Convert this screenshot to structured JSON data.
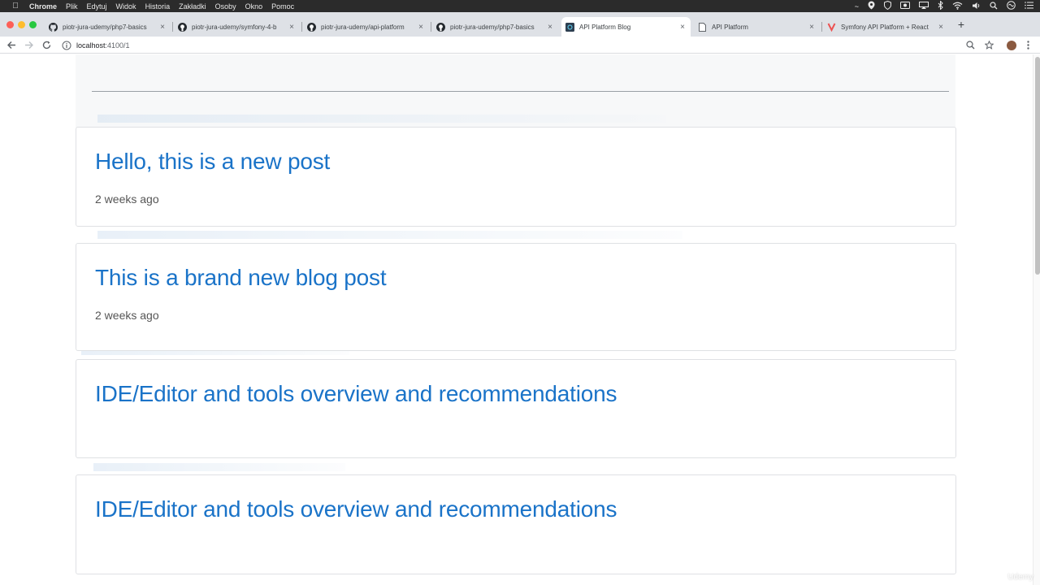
{
  "menubar": {
    "app": "Chrome",
    "items": [
      "Plik",
      "Edytuj",
      "Widok",
      "Historia",
      "Zakładki",
      "Osoby",
      "Okno",
      "Pomoc"
    ]
  },
  "tabs": [
    {
      "title": "piotr-jura-udemy/php7-basics",
      "icon": "github-icon",
      "active": false
    },
    {
      "title": "piotr-jura-udemy/symfony-4-b",
      "icon": "github-icon",
      "active": false
    },
    {
      "title": "piotr-jura-udemy/api-platform",
      "icon": "github-icon",
      "active": false
    },
    {
      "title": "piotr-jura-udemy/php7-basics",
      "icon": "github-icon",
      "active": false
    },
    {
      "title": "API Platform Blog",
      "icon": "react-app-icon",
      "active": true
    },
    {
      "title": "API Platform",
      "icon": "page-icon",
      "active": false
    },
    {
      "title": "Symfony API Platform + React",
      "icon": "udemy-icon",
      "active": false
    }
  ],
  "address_bar": {
    "host": "localhost",
    "path": ":4100/1"
  },
  "posts": [
    {
      "title": "Hello, this is a new post",
      "date": "2 weeks ago"
    },
    {
      "title": "This is a brand new blog post",
      "date": "2 weeks ago"
    },
    {
      "title": "IDE/Editor and tools overview and recommendations",
      "date": ""
    },
    {
      "title": "IDE/Editor and tools overview and recommendations",
      "date": ""
    }
  ],
  "watermark": "Udemy",
  "colors": {
    "link": "#1a73c8",
    "menubar_bg": "#2b2b2b",
    "tabstrip_bg": "#dee1e6"
  }
}
